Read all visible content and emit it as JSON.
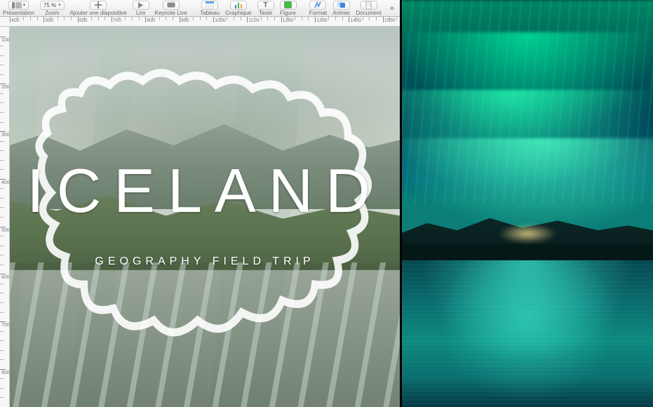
{
  "toolbar": {
    "presentation_label": "Présentation",
    "zoom_label": "Zoom",
    "zoom_value": "75 %",
    "add_slide_label": "Ajouter une diapositive",
    "play_label": "Lire",
    "keynote_live_label": "Keynote Live",
    "table_label": "Tableau",
    "chart_label": "Graphique",
    "text_label": "Texte",
    "shape_label": "Figure",
    "format_label": "Format",
    "animate_label": "Animer",
    "document_label": "Document"
  },
  "ruler": {
    "h_ticks": [
      "400",
      "500",
      "600",
      "700",
      "800",
      "900",
      "1000",
      "1100",
      "1200",
      "1300",
      "1400",
      "1500"
    ],
    "v_ticks": [
      "100",
      "200",
      "300",
      "400",
      "500",
      "600",
      "700",
      "800"
    ]
  },
  "slide": {
    "title": "ICELAND",
    "subtitle": "GEOGRAPHY FIELD TRIP"
  }
}
